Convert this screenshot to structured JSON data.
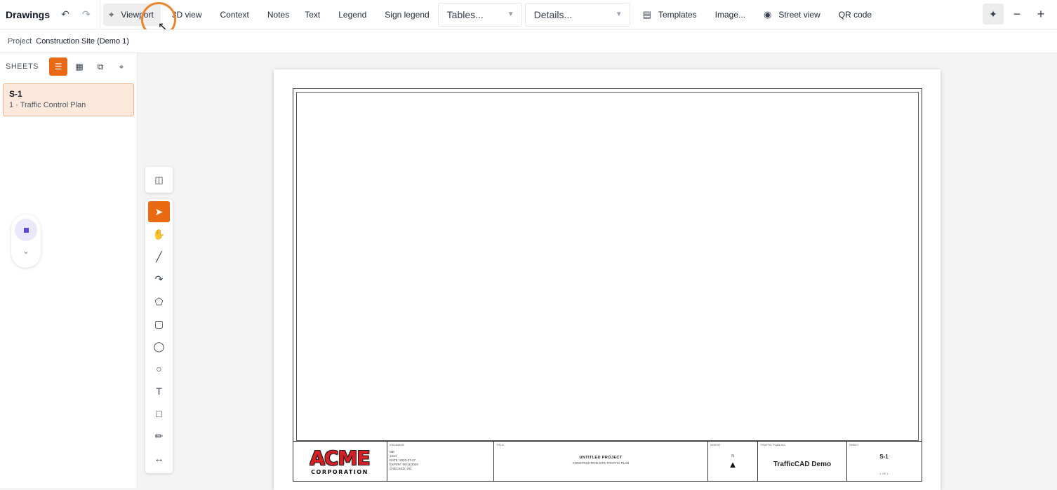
{
  "app": {
    "title": "Drawings"
  },
  "toolbar": {
    "undo_icon": "undo-icon",
    "redo_icon": "redo-icon",
    "viewport_label": "Viewport",
    "view3d_label": "3D view",
    "context_label": "Context",
    "notes_label": "Notes",
    "text_label": "Text",
    "legend_label": "Legend",
    "sign_legend_label": "Sign legend",
    "tables_select": "Tables...",
    "details_select": "Details...",
    "templates_label": "Templates",
    "image_label": "Image...",
    "street_view_label": "Street view",
    "qr_code_label": "QR code"
  },
  "project": {
    "label": "Project",
    "name": "Construction Site (Demo 1)"
  },
  "sidebar": {
    "title": "SHEETS",
    "sheets": [
      {
        "code": "S-1",
        "name": "1 · Traffic Control Plan"
      }
    ]
  },
  "tools": [
    "stamp",
    "select",
    "pan",
    "line",
    "arc",
    "polygon",
    "rectangle",
    "circle",
    "small-circle",
    "text",
    "comment",
    "measure",
    "dimension"
  ],
  "title_block": {
    "logo_main": "ACME",
    "logo_sub": "CORPORATION",
    "caption_engineer": "ENGINEER",
    "caption_title": "TITLE",
    "caption_north": "NORTH",
    "caption_plan": "TRAFFIC PLAN NO.",
    "caption_sheet": "SHEET",
    "engineer_lines": [
      "MD",
      "1234",
      "DATE: 2020-07-27",
      "EXPIRY: 06/11/2020",
      "CHECKED: DG"
    ],
    "project_title": "UNTITLED PROJECT",
    "project_subtitle": "CONSTRUCTION SITE TRAFFIC PLAN",
    "north_letter": "N",
    "brand": "TrafficCAD Demo",
    "sheet_number": "S-1",
    "sheet_of": "1 OF 1"
  },
  "colors": {
    "accent": "#ea6a14",
    "cursor_highlight": "#e8852e",
    "logo_red": "#d81f26"
  }
}
